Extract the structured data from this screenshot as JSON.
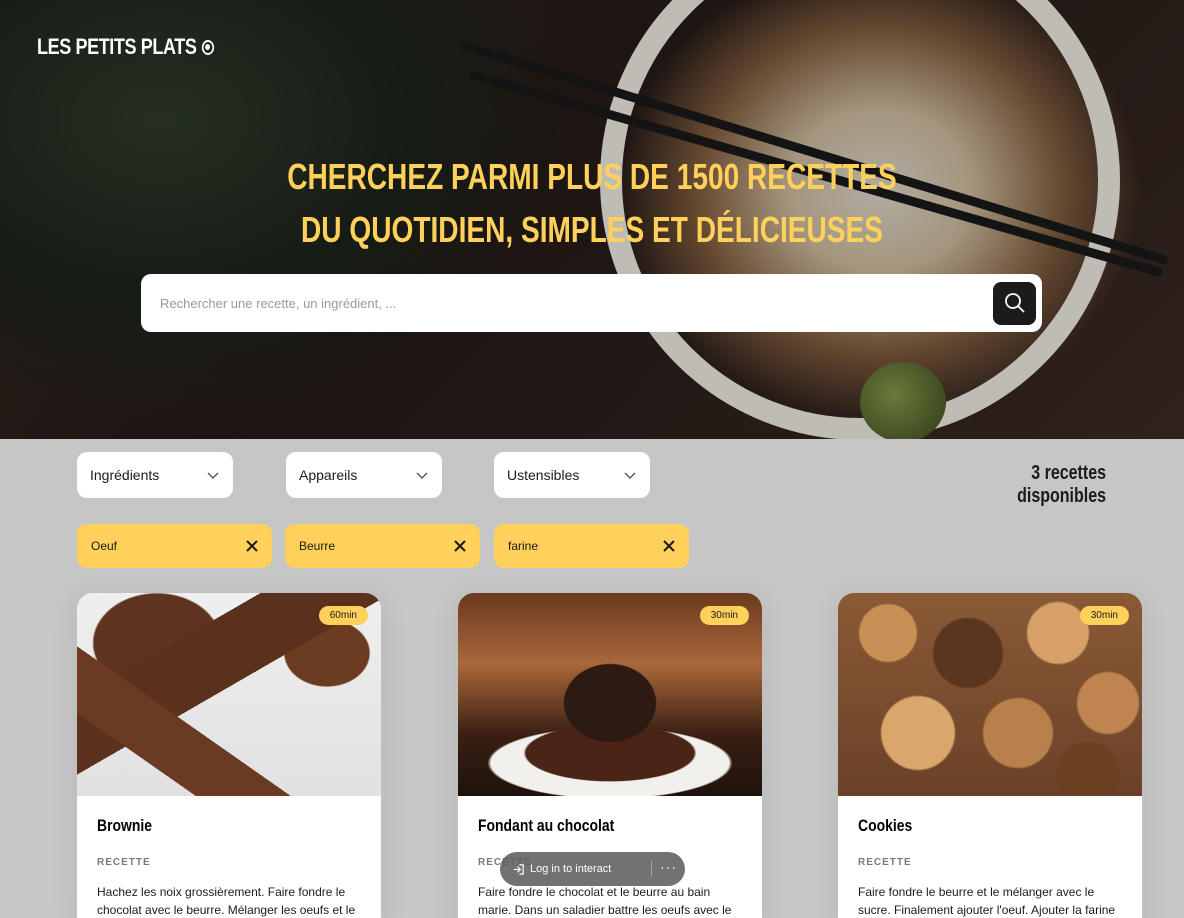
{
  "hero": {
    "logo": "LES PETITS PLATS",
    "headline_line1": "CHERCHEZ PARMI PLUS DE 1500 RECETTES",
    "headline_line2": "DU QUOTIDIEN, SIMPLES ET DÉLICIEUSES",
    "search_placeholder": "Rechercher une recette, un ingrédient, ..."
  },
  "filters": {
    "dropdowns": [
      {
        "label": "Ingrédients"
      },
      {
        "label": "Appareils"
      },
      {
        "label": "Ustensibles"
      }
    ],
    "count": "3 recettes disponibles",
    "tags": [
      {
        "label": "Oeuf"
      },
      {
        "label": "Beurre"
      },
      {
        "label": "farine"
      }
    ]
  },
  "recipes": [
    {
      "title": "Brownie",
      "time": "60min",
      "label": "RECETTE",
      "text": "Hachez les noix grossièrement. Faire fondre le chocolat avec le beurre. Mélanger les oeufs et le"
    },
    {
      "title": "Fondant au chocolat",
      "time": "30min",
      "label": "RECETTE",
      "text": "Faire fondre le chocolat et le beurre au bain marie. Dans un saladier battre les oeufs avec le sucre"
    },
    {
      "title": "Cookies",
      "time": "30min",
      "label": "RECETTE",
      "text": "Faire fondre le beurre et le mélanger avec le sucre. Finalement ajouter l'oeuf. Ajouter la farine tout en"
    }
  ],
  "overlay": {
    "login_label": "Log in to interact",
    "more_label": "···"
  },
  "colors": {
    "accent": "#ffd15b",
    "dark": "#1b1b1b",
    "page_bg": "#c6c6c6"
  }
}
